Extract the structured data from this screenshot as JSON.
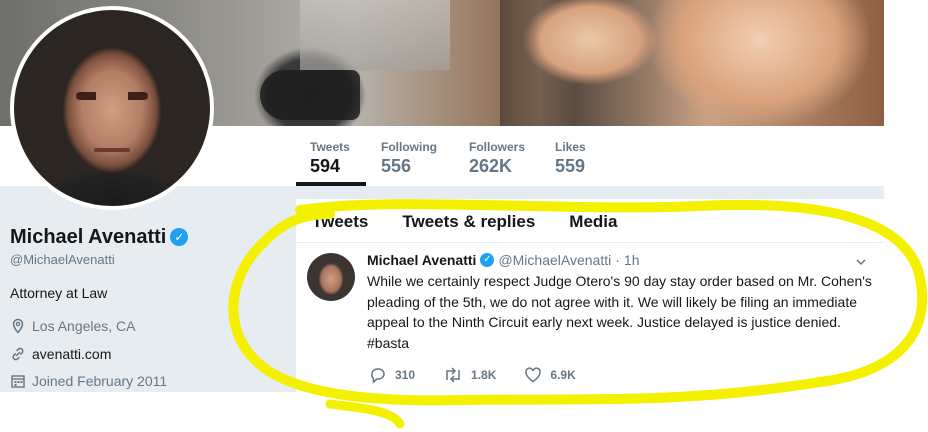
{
  "profile": {
    "name": "Michael Avenatti",
    "handle": "@MichaelAvenatti",
    "bio": "Attorney at Law",
    "location": "Los Angeles, CA",
    "website": "avenatti.com",
    "joined": "Joined February 2011"
  },
  "stats": [
    {
      "label": "Tweets",
      "value": "594"
    },
    {
      "label": "Following",
      "value": "556"
    },
    {
      "label": "Followers",
      "value": "262K"
    },
    {
      "label": "Likes",
      "value": "559"
    }
  ],
  "tabs": [
    "Tweets",
    "Tweets & replies",
    "Media"
  ],
  "tweet": {
    "name": "Michael Avenatti",
    "handle": "@MichaelAvenatti",
    "separator": "·",
    "time": "1h",
    "text_lines": [
      "While we certainly respect Judge Otero's 90 day stay order based on Mr. Cohen's",
      "pleading of the 5th, we do not agree with it. We will likely be filing an immediate",
      "appeal to the Ninth Circuit early next week. Justice delayed is justice denied.",
      "#basta"
    ],
    "replies": "310",
    "retweets": "1.8K",
    "likes": "6.9K"
  },
  "colors": {
    "accent": "#1da1f2",
    "highlight": "#f3f000",
    "panel": "#e6ecf0"
  },
  "icons": {
    "verified": "verified-check-icon",
    "location": "location-pin-icon",
    "link": "link-icon",
    "calendar": "calendar-icon",
    "reply": "reply-icon",
    "retweet": "retweet-icon",
    "like": "heart-icon",
    "more": "chevron-down-icon"
  }
}
